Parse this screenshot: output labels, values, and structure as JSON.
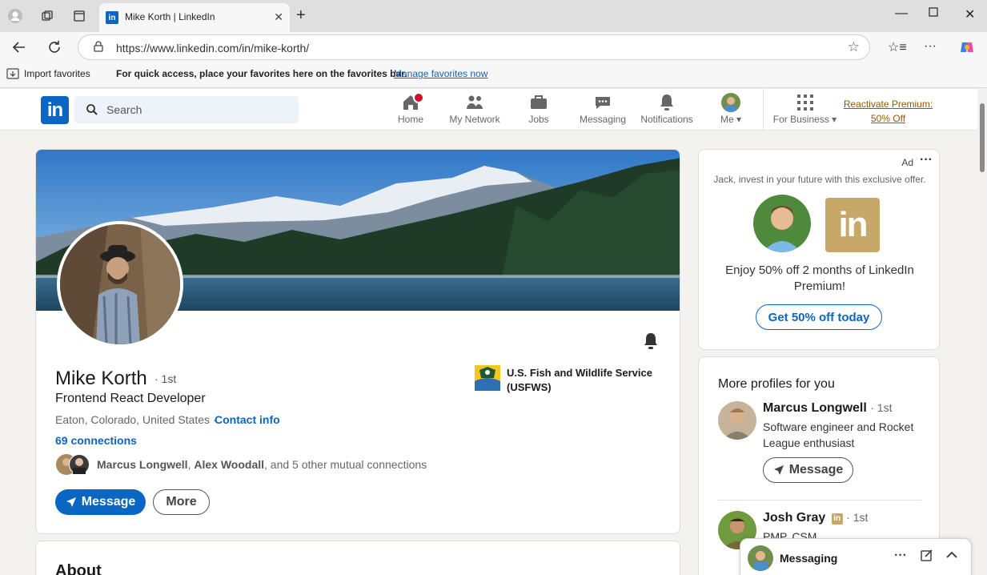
{
  "browser": {
    "tab_title": "Mike Korth | LinkedIn",
    "url": "https://www.linkedin.com/in/mike-korth/",
    "favorites_import": "Import favorites",
    "favorites_hint": "For quick access, place your favorites here on the favorites bar.",
    "favorites_manage": "Manage favorites now"
  },
  "header": {
    "logo": "in",
    "search_placeholder": "Search",
    "nav": [
      {
        "label": "Home",
        "icon": "home-icon",
        "notification": true
      },
      {
        "label": "My Network",
        "icon": "people-icon"
      },
      {
        "label": "Jobs",
        "icon": "briefcase-icon"
      },
      {
        "label": "Messaging",
        "icon": "chat-icon"
      },
      {
        "label": "Notifications",
        "icon": "bell-icon"
      },
      {
        "label": "Me",
        "icon": "avatar"
      }
    ],
    "for_business": "For Business",
    "premium_line1": "Reactivate Premium:",
    "premium_line2": "50% Off"
  },
  "profile": {
    "name": "Mike Korth",
    "degree": "· 1st",
    "headline": "Frontend React Developer",
    "location": "Eaton, Colorado, United States ·",
    "contact_info": "Contact info",
    "connections": "69 connections",
    "mutual_name1": "Marcus Longwell",
    "mutual_sep": ", ",
    "mutual_name2": "Alex Woodall",
    "mutual_rest": ", and 5 other mutual connections",
    "message_btn": "Message",
    "more_btn": "More",
    "company_line1": "U.S. Fish and Wildlife Service",
    "company_line2": "(USFWS)"
  },
  "about": {
    "title": "About"
  },
  "ad": {
    "label": "Ad",
    "subtitle": "Jack, invest in your future with this exclusive offer.",
    "copy": "Enjoy 50% off 2 months of LinkedIn Premium!",
    "cta": "Get 50% off today"
  },
  "more_profiles": {
    "title": "More profiles for you",
    "people": [
      {
        "name": "Marcus Longwell",
        "degree": "· 1st",
        "headline": "Software engineer and Rocket League enthusiast",
        "button": "Message"
      },
      {
        "name": "Josh Gray",
        "degree": "· 1st",
        "headline": "PMP, CSM"
      }
    ]
  },
  "messaging": {
    "label": "Messaging"
  },
  "colors": {
    "brand": "#0a66c2",
    "premium": "#915907",
    "background": "#f4f2ee"
  }
}
